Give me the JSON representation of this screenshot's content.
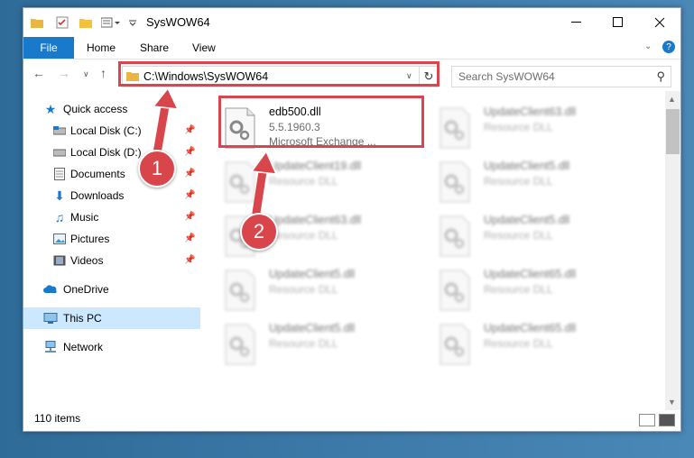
{
  "window": {
    "title": "SysWOW64"
  },
  "ribbon": {
    "file": "File",
    "tabs": [
      "Home",
      "Share",
      "View"
    ]
  },
  "address": {
    "path": "C:\\Windows\\SysWOW64"
  },
  "search": {
    "placeholder": "Search SysWOW64"
  },
  "sidebar": {
    "items": [
      {
        "label": "Quick access"
      },
      {
        "label": "Local Disk (C:)"
      },
      {
        "label": "Local Disk (D:)"
      },
      {
        "label": "Documents"
      },
      {
        "label": "Downloads"
      },
      {
        "label": "Music"
      },
      {
        "label": "Pictures"
      },
      {
        "label": "Videos"
      },
      {
        "label": "OneDrive"
      },
      {
        "label": "This PC"
      },
      {
        "label": "Network"
      }
    ]
  },
  "files": {
    "highlighted": {
      "name": "edb500.dll",
      "version": "5.5.1960.3",
      "description": "Microsoft Exchange ..."
    },
    "others": [
      {
        "name": "UpdateClient63.dll",
        "description": "Resource DLL"
      },
      {
        "name": "UpdateClient19.dll",
        "description": "Resource DLL"
      },
      {
        "name": "UpdateClient5.dll",
        "description": "Resource DLL"
      },
      {
        "name": "UpdateClient63.dll",
        "description": "Resource DLL"
      },
      {
        "name": "UpdateClient5.dll",
        "description": "Resource DLL"
      },
      {
        "name": "UpdateClient5.dll",
        "description": "Resource DLL"
      },
      {
        "name": "UpdateClient65.dll",
        "description": "Resource DLL"
      },
      {
        "name": "UpdateClient5.dll",
        "description": "Resource DLL"
      },
      {
        "name": "UpdateClient65.dll",
        "description": "Resource DLL"
      }
    ]
  },
  "status": {
    "count": "110 items"
  },
  "badges": {
    "one": "1",
    "two": "2"
  },
  "colors": {
    "accent": "#1979ca",
    "highlight": "#d9464f",
    "selection": "#cce8ff"
  }
}
